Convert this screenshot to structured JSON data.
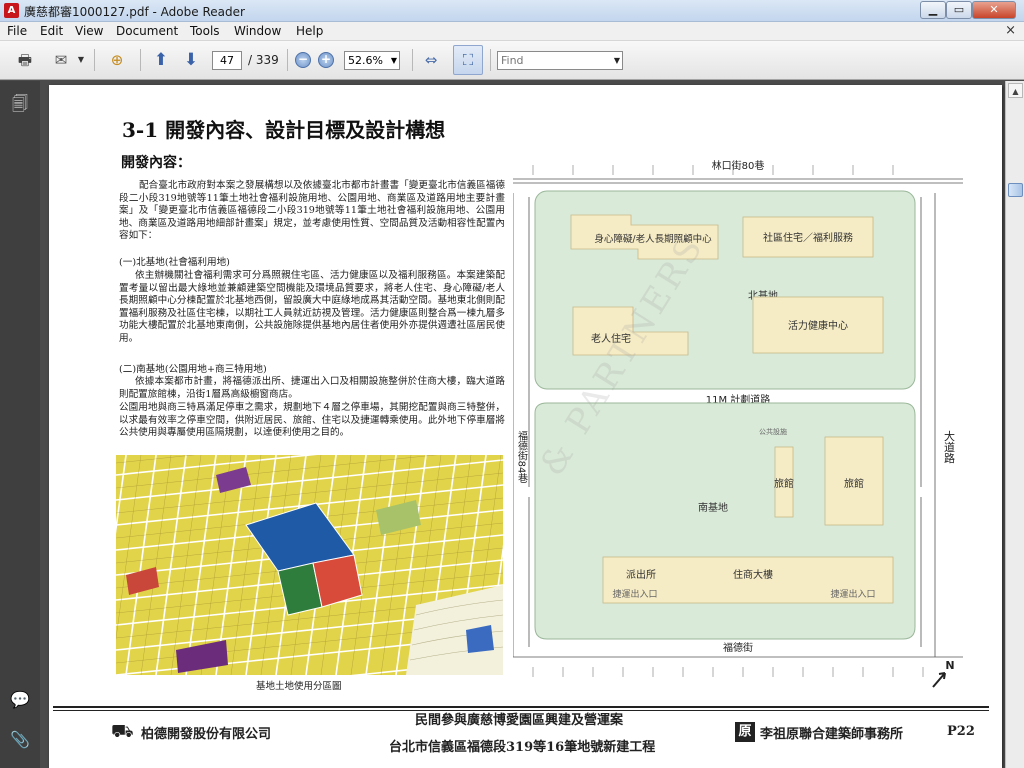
{
  "window": {
    "title": "廣慈都審1000127.pdf - Adobe Reader",
    "min_icon": "minimize-icon",
    "max_icon": "maximize-icon",
    "close_icon": "close-icon"
  },
  "menu": {
    "items": [
      "File",
      "Edit",
      "View",
      "Document",
      "Tools",
      "Window",
      "Help"
    ],
    "close_glyph": "×"
  },
  "toolbar": {
    "current_page": "47",
    "total_pages": "/ 339",
    "zoom": "52.6%",
    "find_placeholder": "Find"
  },
  "page": {
    "heading": "3-1 開發內容、設計目標及設計構想",
    "subheading": "開發內容：",
    "intro": "配合臺北市政府對本案之發展構想以及依據臺北市都市計畫書「變更臺北市信義區福德段二小段319地號等11筆土地社會福利設施用地、公園用地、商業區及道路用地主要計畫案」及「變更臺北市信義區福德段二小段319地號等11筆土地社會福利設施用地、公園用地、商業區及道路用地細部計畫案」規定，並考慮使用性質、空間品質及活動相容性配置內容如下：",
    "north_heading": "(一)北基地(社會福利用地)",
    "north_text": "依主辦機關社會福利需求可分爲照親住宅區、活力健康區以及福利服務區。本案建築配置考量以留出最大綠地並兼顧建築空間機能及環境品質要求，將老人住宅、身心障礙/老人長期照顧中心分棟配置於北基地西側，留設廣大中庭綠地成爲其活動空間。基地東北側則配置福利服務及社區住宅棟，以期社工人員就近訪視及管理。活力健康區則整合爲一棟九層多功能大樓配置於北基地東南側，公共設施除提供基地內居住者使用外亦提供週遭社區居民使用。",
    "south_heading": "(二)南基地(公園用地+商三特用地)",
    "south_text": "依據本案都市計畫，將福德派出所、捷運出入口及相關設施整併於住商大樓，臨大道路則配置旅館棟，沿街1層爲高級櫥窗商店。",
    "south_text2": "公園用地與商三特爲滿足停車之需求，規劃地下４層之停車場，其開挖配置與商三特整併，以求最有效率之停車空間，供附近居民、旅館、住宅以及捷運轉乘使用。此外地下停車層將公共使用與專屬使用區隔規劃，以達便利使用之目的。",
    "zoning_caption": "基地土地使用分區圖",
    "watermark": "& PARTNERS"
  },
  "siteplan": {
    "top_street": "林口街80巷",
    "north_site": "北基地",
    "disabled_center": "身心障礙/老人長期照顧中心",
    "community_housing": "社區住宅／福利服務",
    "health_center": "活力健康中心",
    "senior_housing": "老人住宅",
    "planned_road": "11M 計劃道路",
    "west_lane": "福德街84巷",
    "public_facility": "公共設施",
    "hotel1": "旅館",
    "hotel2": "旅館",
    "south_site": "南基地",
    "police": "派出所",
    "mixed_building": "住商大樓",
    "metro_exit1": "捷運出入口",
    "metro_exit2": "捷運出入口",
    "bottom_street": "福德街",
    "east_road": "大道路",
    "north_arrow": "N"
  },
  "footer": {
    "company": "柏德開發股份有限公司",
    "title1": "民間參與廣慈博愛園區興建及營運案",
    "title2": "台北市信義區福德段319等16筆地號新建工程",
    "architect_mark": "原",
    "architect": "李祖原聯合建築師事務所",
    "page_no": "P22"
  },
  "colors": {
    "green_site": "#d9ead8",
    "building": "#f5ebc4",
    "zoning_blue": "#1f5aa6",
    "zoning_green": "#2f7d3c",
    "zoning_red": "#d84a3a",
    "zoning_yellow": "#e6d94a"
  }
}
